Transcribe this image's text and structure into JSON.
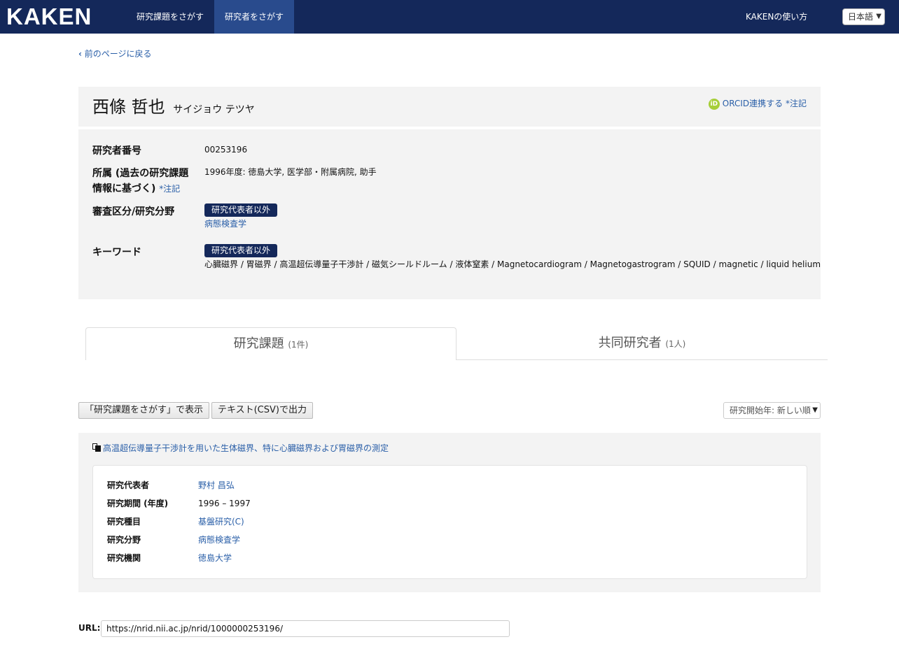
{
  "navbar": {
    "logo": "KAKEN",
    "items": [
      {
        "label": "研究課題をさがす"
      },
      {
        "label": "研究者をさがす"
      }
    ],
    "help_link": "KAKENの使い方",
    "language": "日本語"
  },
  "back_link": "前のページに戻る",
  "researcher": {
    "name": "西條 哲也",
    "name_kana": "サイジョウ テツヤ",
    "orcid_link": "ORCID連携する",
    "orcid_note": "*注記"
  },
  "info": {
    "number_label": "研究者番号",
    "number_value": "00253196",
    "affiliation_label_line1": "所属 (過去の研究課題",
    "affiliation_label_line2": "情報に基づく)",
    "affiliation_note": "*注記",
    "affiliation_value": "1996年度: 徳島大学, 医学部・附属病院, 助手",
    "field_label": "審査区分/研究分野",
    "field_tag": "研究代表者以外",
    "field_value": "病態検査学",
    "keyword_label": "キーワード",
    "keyword_tag": "研究代表者以外",
    "keywords": "心臓磁界 / 胃磁界 / 高温超伝導量子干渉計 / 磁気シールドルーム / 液体窒素 / Magnetocardiogram / Magnetogastrogram / SQUID / magnetic / liquid helium"
  },
  "tabs": [
    {
      "label": "研究課題",
      "count": "(1件)"
    },
    {
      "label": "共同研究者",
      "count": "(1人)"
    }
  ],
  "toolbar": {
    "search_display_button": "「研究課題をさがす」で表示",
    "csv_button": "テキスト(CSV)で出力",
    "sort_value": "研究開始年: 新しい順"
  },
  "project": {
    "title": "高温超伝導量子干渉計を用いた生体磁界、特に心臓磁界および胃磁界の測定",
    "rows": [
      {
        "label": "研究代表者",
        "value": "野村 昌弘"
      },
      {
        "label": "研究期間 (年度)",
        "value": "1996 – 1997"
      },
      {
        "label": "研究種目",
        "value": "基盤研究(C)"
      },
      {
        "label": "研究分野",
        "value": "病態検査学"
      },
      {
        "label": "研究機関",
        "value": "徳島大学"
      }
    ]
  },
  "url": {
    "label": "URL:",
    "value": "https://nrid.nii.ac.jp/nrid/1000000253196/"
  }
}
